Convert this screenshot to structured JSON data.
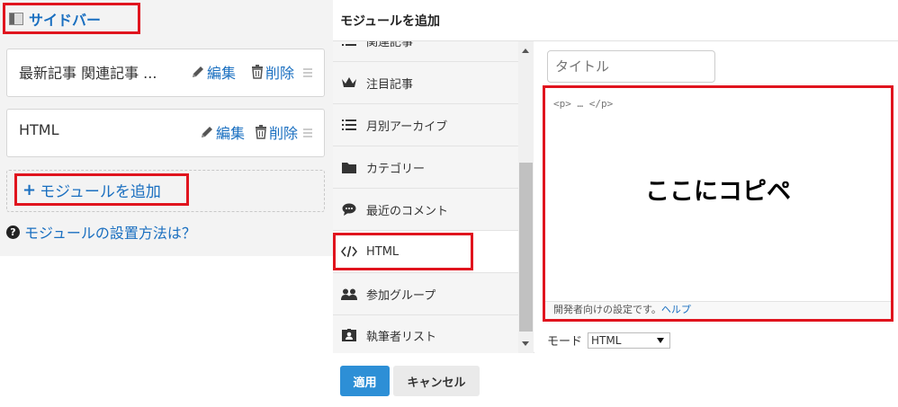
{
  "sidebar": {
    "title": "サイドバー",
    "modules": [
      {
        "name": "最新記事 関連記事 ...",
        "edit": "編集",
        "delete": "削除"
      },
      {
        "name": "HTML",
        "edit": "編集",
        "delete": "削除"
      }
    ],
    "add_module": "モジュールを追加",
    "howto": "モジュールの設置方法は？"
  },
  "dialog": {
    "title": "モジュールを追加",
    "list": [
      {
        "label": "関連記事",
        "icon": "list-icon"
      },
      {
        "label": "注目記事",
        "icon": "crown-icon"
      },
      {
        "label": "月別アーカイブ",
        "icon": "list-icon"
      },
      {
        "label": "カテゴリー",
        "icon": "folder-icon"
      },
      {
        "label": "最近のコメント",
        "icon": "comment-icon"
      },
      {
        "label": "HTML",
        "icon": "code-icon"
      },
      {
        "label": "参加グループ",
        "icon": "users-icon"
      },
      {
        "label": "執筆者リスト",
        "icon": "id-card-icon"
      }
    ],
    "title_placeholder": "タイトル",
    "editor_code": "<p> … </p>",
    "editor_annotation": "ここにコピペ",
    "editor_footer": "開発者向けの設定です。",
    "editor_footer_link": "ヘルプ",
    "mode_label": "モード",
    "mode_value": "HTML",
    "apply": "適用",
    "cancel": "キャンセル"
  },
  "colors": {
    "accent": "#1a6fc0",
    "highlight": "#e0141e",
    "apply_button": "#2d8fd6"
  }
}
